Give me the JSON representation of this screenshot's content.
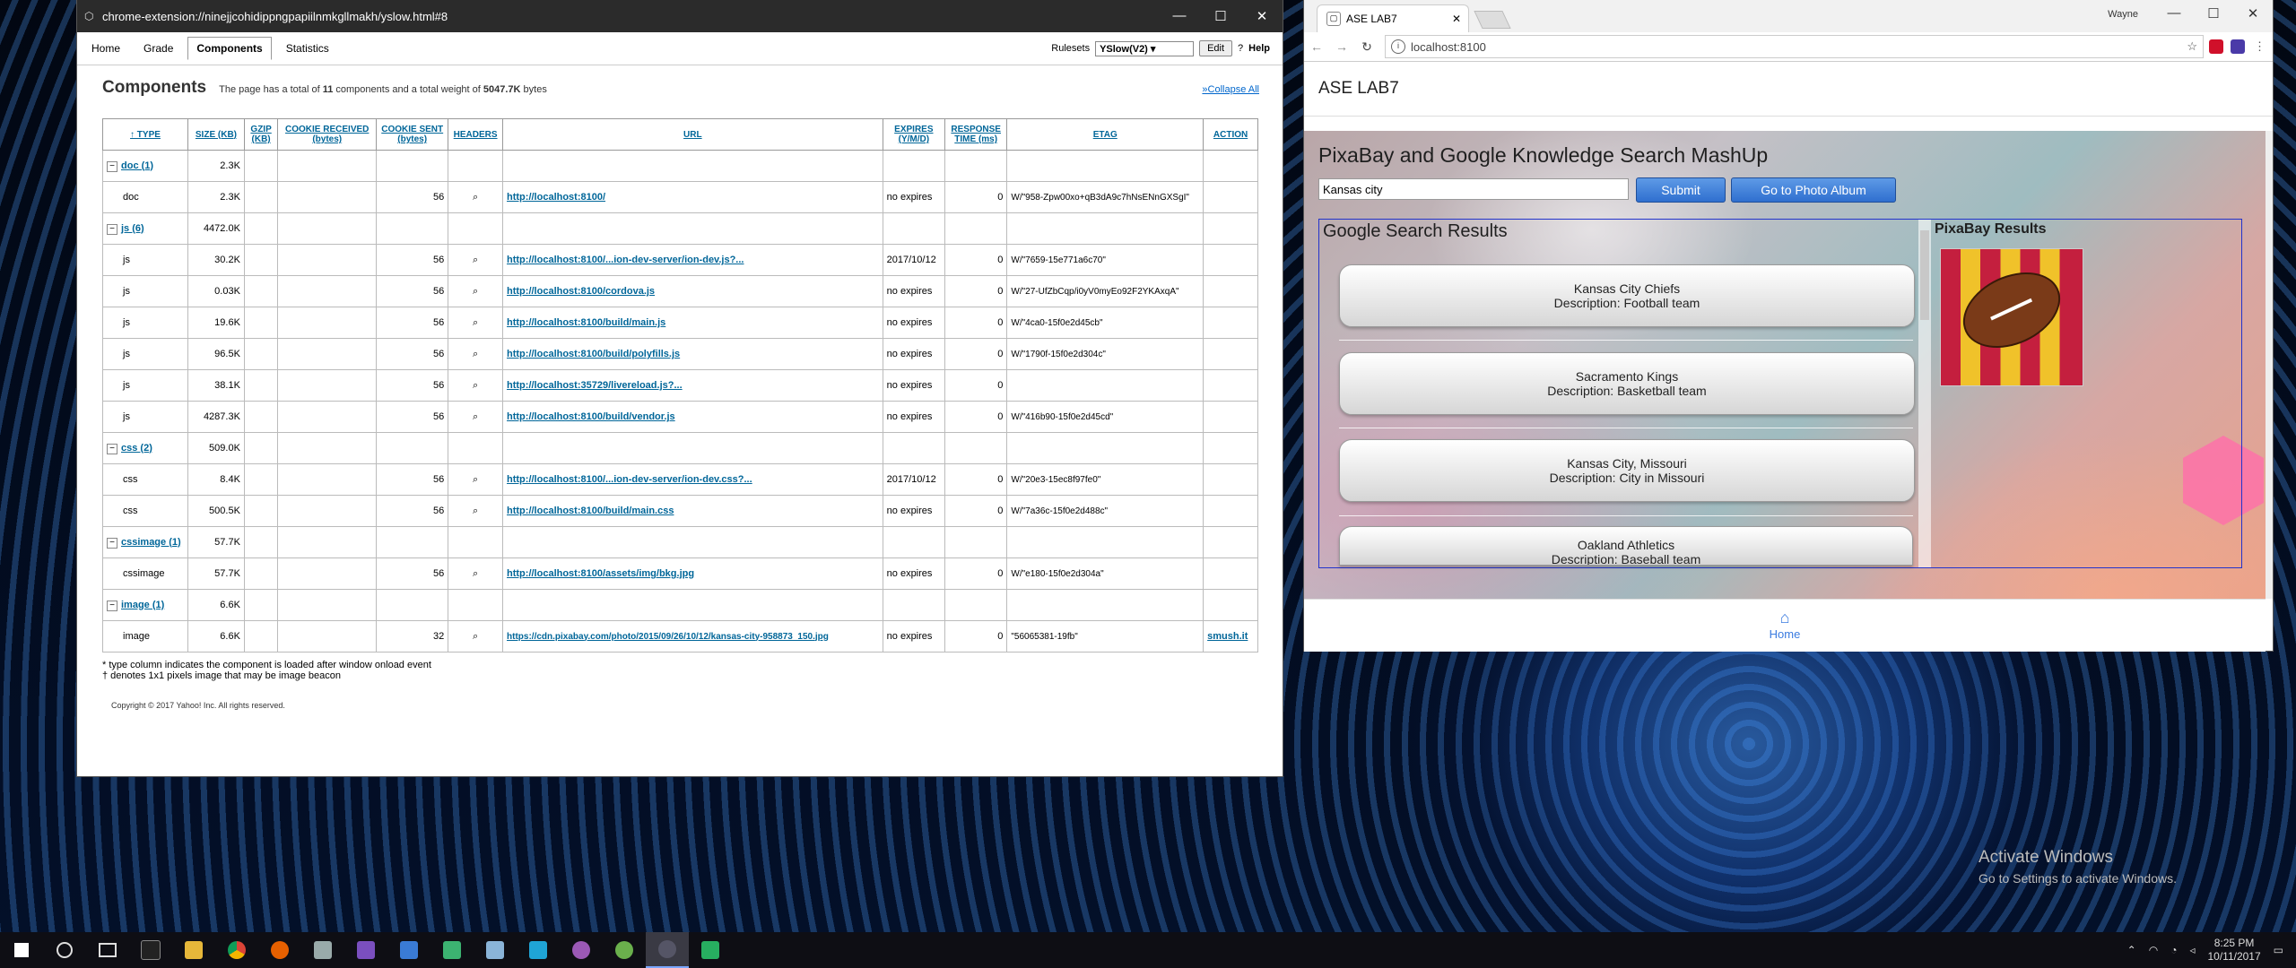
{
  "yslow": {
    "title": "chrome-extension://ninejjcohidippngpapiilnmkgllmakh/yslow.html#8",
    "tabs": [
      "Home",
      "Grade",
      "Components",
      "Statistics"
    ],
    "rulesets_label": "Rulesets",
    "ruleset_value": "YSlow(V2)",
    "edit_label": "Edit",
    "help_label": "Help",
    "heading": "Components",
    "summary_prefix": "The page has a total of ",
    "summary_count": "11",
    "summary_mid": " components and a total weight of ",
    "summary_weight": "5047.7K",
    "summary_suffix": " bytes",
    "collapse_all": "»Collapse All",
    "columns": [
      "↑ TYPE",
      "SIZE (KB)",
      "GZIP (KB)",
      "COOKIE RECEIVED (bytes)",
      "COOKIE SENT (bytes)",
      "HEADERS",
      "URL",
      "EXPIRES (Y/M/D)",
      "RESPONSE TIME (ms)",
      "ETAG",
      "ACTION"
    ],
    "rows": [
      {
        "group": true,
        "type": "doc (1)",
        "size": "2.3K"
      },
      {
        "type": "doc",
        "size": "2.3K",
        "cookie_sent": "56",
        "url": "http://localhost:8100/",
        "expires": "no expires",
        "response": "0",
        "etag": "W/\"958-Zpw00xo+qB3dA9c7hNsENnGXSgI\""
      },
      {
        "group": true,
        "type": "js (6)",
        "size": "4472.0K"
      },
      {
        "type": "js",
        "size": "30.2K",
        "cookie_sent": "56",
        "url": "http://localhost:8100/...ion-dev-server/ion-dev.js?...",
        "expires": "2017/10/12",
        "response": "0",
        "etag": "W/\"7659-15e771a6c70\""
      },
      {
        "type": "js",
        "size": "0.03K",
        "cookie_sent": "56",
        "url": "http://localhost:8100/cordova.js",
        "expires": "no expires",
        "response": "0",
        "etag": "W/\"27-UfZbCqp/i0yV0myEo92F2YKAxqA\""
      },
      {
        "type": "js",
        "size": "19.6K",
        "cookie_sent": "56",
        "url": "http://localhost:8100/build/main.js",
        "expires": "no expires",
        "response": "0",
        "etag": "W/\"4ca0-15f0e2d45cb\""
      },
      {
        "type": "js",
        "size": "96.5K",
        "cookie_sent": "56",
        "url": "http://localhost:8100/build/polyfills.js",
        "expires": "no expires",
        "response": "0",
        "etag": "W/\"1790f-15f0e2d304c\""
      },
      {
        "type": "js",
        "size": "38.1K",
        "cookie_sent": "56",
        "url": "http://localhost:35729/livereload.js?...",
        "expires": "no expires",
        "response": "0",
        "etag": ""
      },
      {
        "type": "js",
        "size": "4287.3K",
        "cookie_sent": "56",
        "url": "http://localhost:8100/build/vendor.js",
        "expires": "no expires",
        "response": "0",
        "etag": "W/\"416b90-15f0e2d45cd\""
      },
      {
        "group": true,
        "type": "css (2)",
        "size": "509.0K"
      },
      {
        "type": "css",
        "size": "8.4K",
        "cookie_sent": "56",
        "url": "http://localhost:8100/...ion-dev-server/ion-dev.css?...",
        "expires": "2017/10/12",
        "response": "0",
        "etag": "W/\"20e3-15ec8f97fe0\""
      },
      {
        "type": "css",
        "size": "500.5K",
        "cookie_sent": "56",
        "url": "http://localhost:8100/build/main.css",
        "expires": "no expires",
        "response": "0",
        "etag": "W/\"7a36c-15f0e2d488c\""
      },
      {
        "group": true,
        "type": "cssimage (1)",
        "size": "57.7K"
      },
      {
        "type": "cssimage",
        "size": "57.7K",
        "cookie_sent": "56",
        "url": "http://localhost:8100/assets/img/bkg.jpg",
        "expires": "no expires",
        "response": "0",
        "etag": "W/\"e180-15f0e2d304a\""
      },
      {
        "group": true,
        "type": "image (1)",
        "size": "6.6K"
      },
      {
        "type": "image",
        "size": "6.6K",
        "cookie_sent": "32",
        "url": "https://cdn.pixabay.com/photo/2015/09/26/10/12/kansas-city-958873_150.jpg",
        "expires": "no expires",
        "response": "0",
        "etag": "\"56065381-19fb\"",
        "action": "smush.it"
      }
    ],
    "footnote1": "* type column indicates the component is loaded after window onload event",
    "footnote2": "† denotes 1x1 pixels image that may be image beacon",
    "copyright": "Copyright © 2017 Yahoo! Inc. All rights reserved."
  },
  "chrome": {
    "tab_title": "ASE LAB7",
    "user": "Wayne",
    "url": "localhost:8100",
    "app_title": "ASE LAB7",
    "mashup_title": "PixaBay and Google Knowledge Search MashUp",
    "search_value": "Kansas city",
    "submit_label": "Submit",
    "album_label": "Go to Photo Album",
    "google_title": "Google Search Results",
    "pixabay_title": "PixaBay Results",
    "results": [
      {
        "name": "Kansas City Chiefs",
        "desc": "Description: Football team"
      },
      {
        "name": "Sacramento Kings",
        "desc": "Description: Basketball team"
      },
      {
        "name": "Kansas City, Missouri",
        "desc": "Description: City in Missouri"
      },
      {
        "name": "Oakland Athletics",
        "desc": "Description: Baseball team"
      }
    ],
    "footer_home": "Home"
  },
  "desktop": {
    "activate_title": "Activate Windows",
    "activate_sub": "Go to Settings to activate Windows.",
    "time": "8:25 PM",
    "date": "10/11/2017"
  }
}
